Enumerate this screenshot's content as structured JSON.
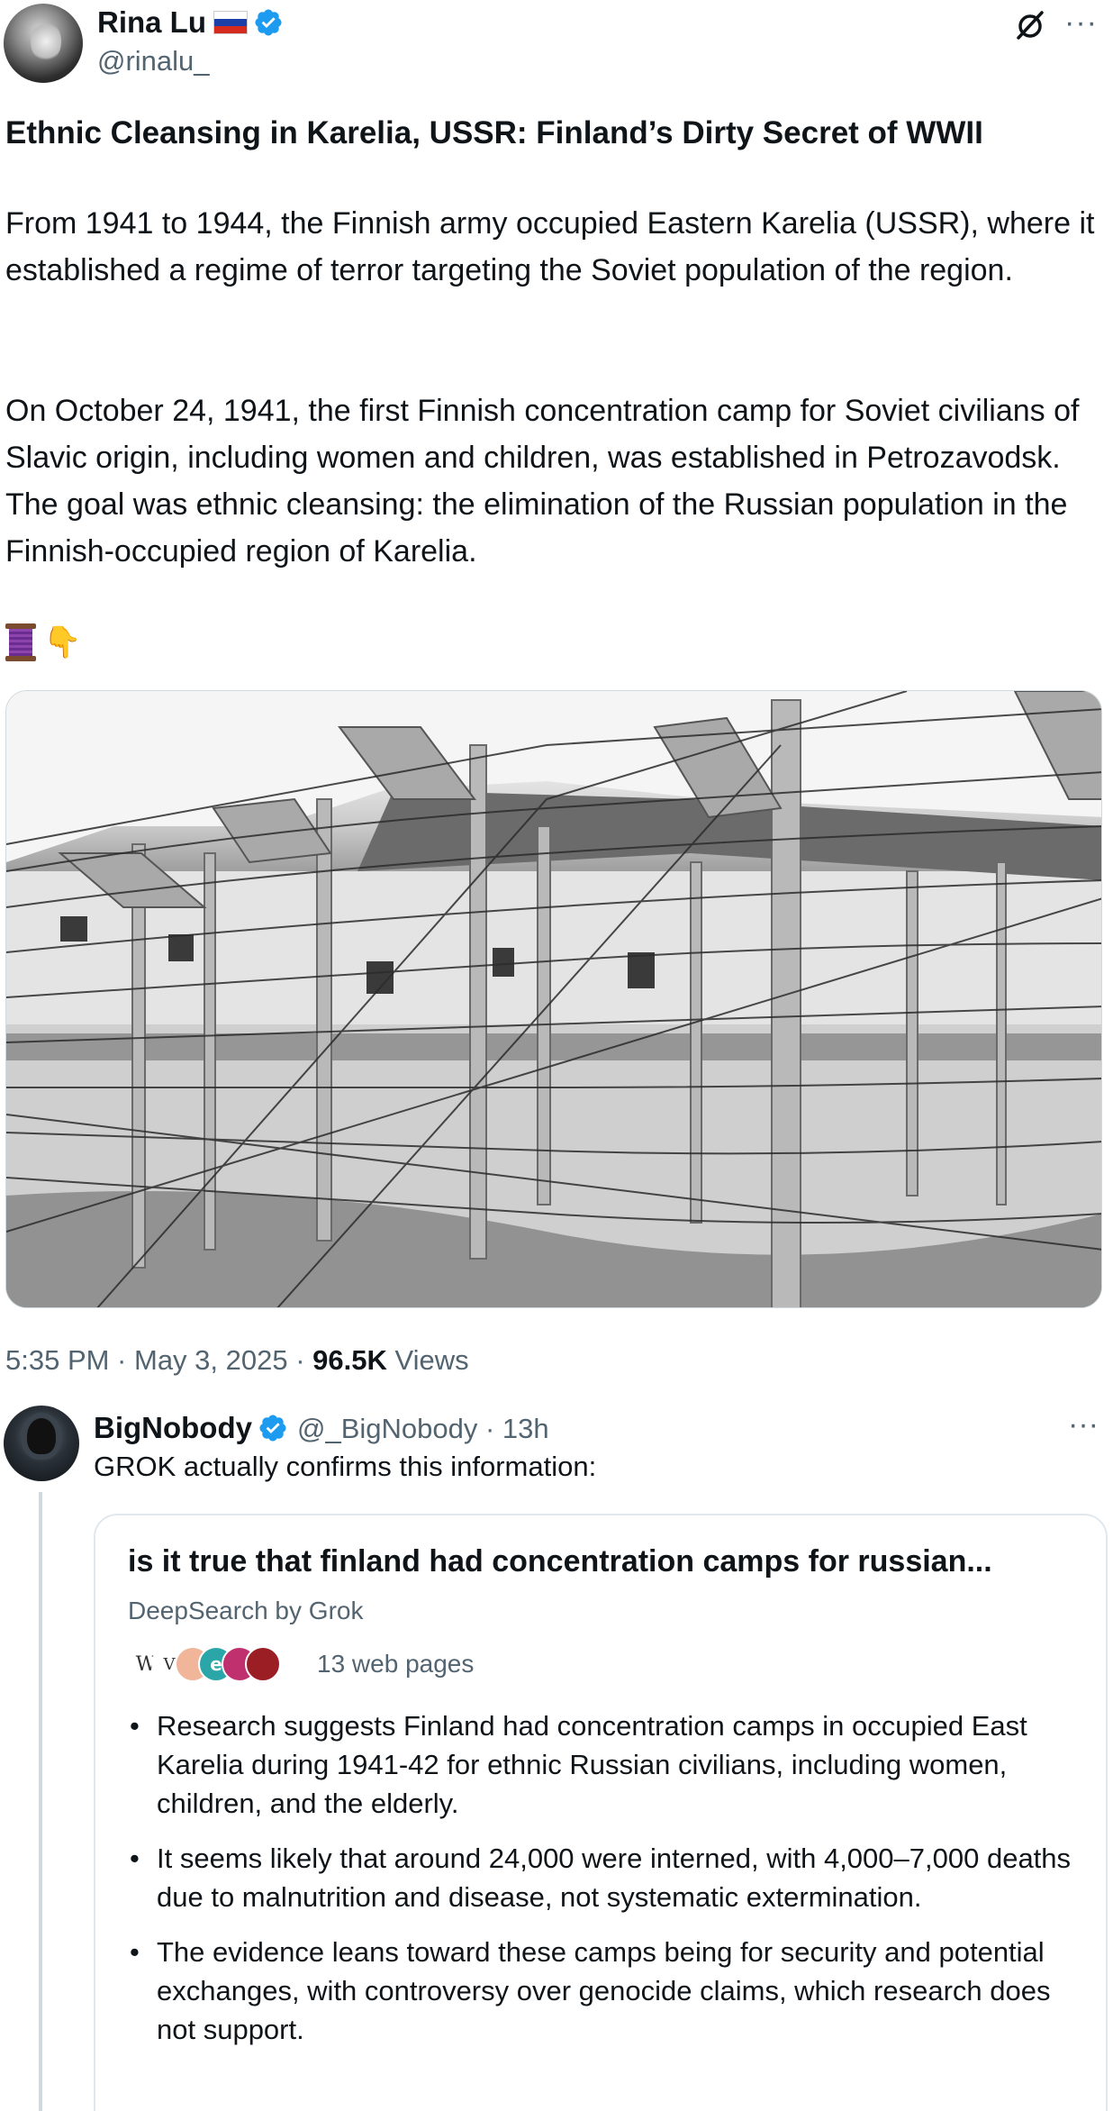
{
  "post": {
    "author": {
      "name": "Rina Lu",
      "handle": "@rinalu_",
      "verified": true,
      "flag": "russia-flag"
    },
    "title": "Ethnic Cleansing in Karelia, USSR: Finland’s Dirty Secret of WWII",
    "paragraphs": [
      "From 1941 to 1944, the Finnish army occupied Eastern Karelia (USSR), where it established a regime of terror targeting the Soviet population of the region.",
      "On October 24, 1941, the first Finnish concentration camp for Soviet civilians of Slavic origin, including women and children, was established in Petrozavodsk. The goal was ethnic cleansing: the elimination of the Russian population in the Finnish-occupied region of Karelia."
    ],
    "emojis": [
      "thread-spool-icon",
      "pointing-down-icon"
    ],
    "time": "5:35 PM · May 3, 2025 · ",
    "views_count": "96.5K",
    "views_label": " Views"
  },
  "reply": {
    "author": {
      "name": "BigNobody",
      "handle": "@_BigNobody",
      "verified": true
    },
    "meta": "@_BigNobody · 13h",
    "text": "GROK actually confirms this information:",
    "card": {
      "title": "is it true that finland had concentration camps for russian...",
      "source": "DeepSearch by Grok",
      "pages": "13 web pages",
      "favicons": [
        "W",
        "V",
        "",
        "e",
        "",
        ""
      ],
      "bullets": [
        "Research suggests Finland had concentration camps in occupied East Karelia during 1941-42 for ethnic Russian civilians, including women, children, and the elderly.",
        "It seems likely that around 24,000 were interned, with 4,000–7,000 deaths due to malnutrition and disease, not systematic extermination.",
        "The evidence leans toward these camps being for security and potential exchanges, with controversy over genocide claims, which research does not support."
      ]
    }
  },
  "colors": {
    "verified": "#1d9bf0",
    "secondary_text": "#536471",
    "primary_text": "#0f1419",
    "border": "#cfd9de"
  }
}
